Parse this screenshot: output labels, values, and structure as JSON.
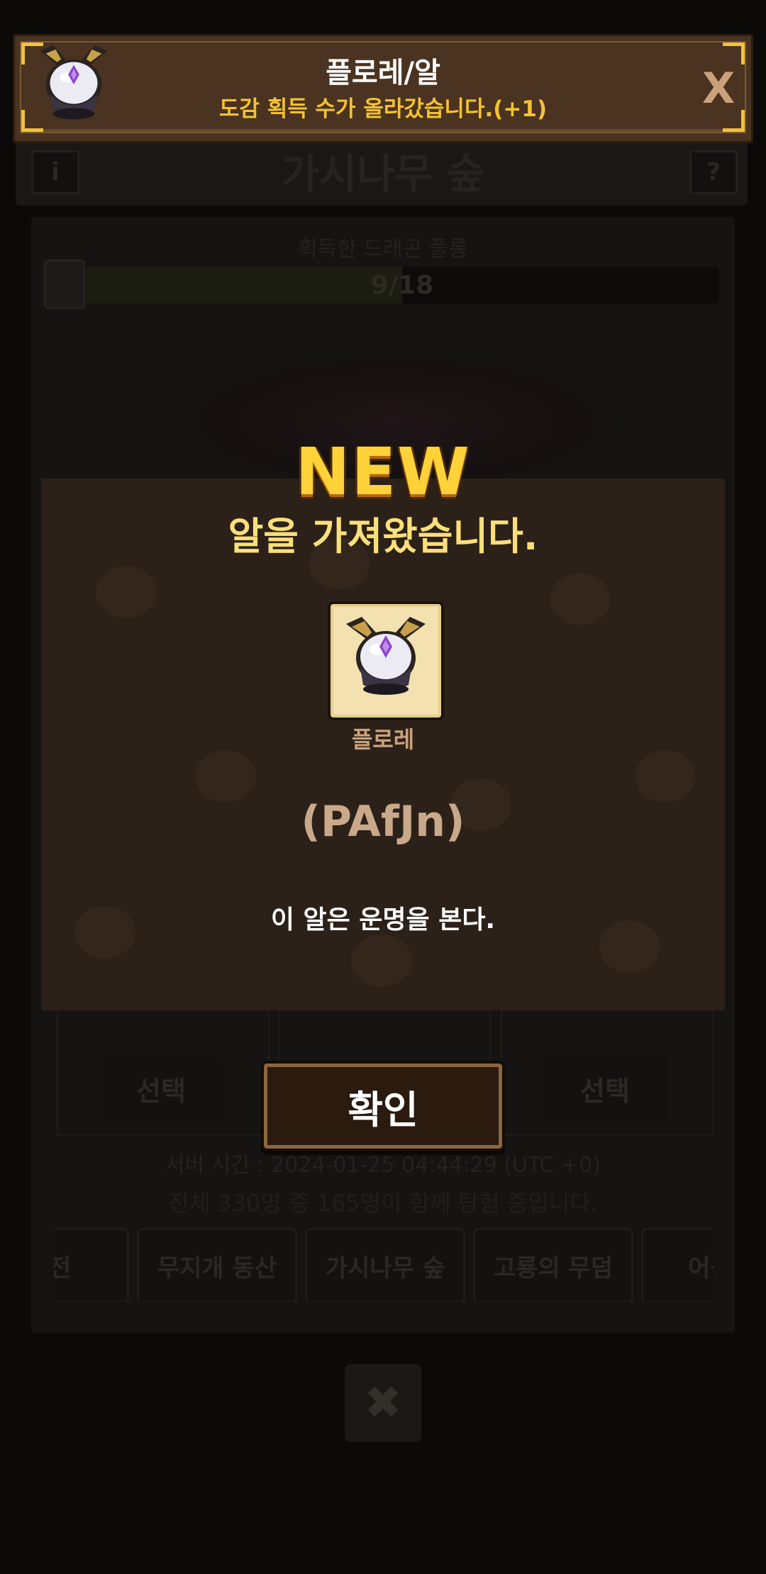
{
  "background": {
    "area_title": "가시나무 숲",
    "info_button": "i",
    "help_button": "?",
    "progress_label": "획득한 드래곤 플롱",
    "progress_value": 0.5,
    "progress_text": "9/18",
    "select_buttons": [
      "선택",
      "선택"
    ],
    "server_time": "서버 시간 : 2024-01-25 04:44:29 (UTC +0)",
    "online_text": "전체 330명 중 165명이 함께 탐험 중입니다.",
    "tabs": [
      "신전",
      "무지개 동산",
      "가시나무 숲",
      "고룡의 무덤",
      "어둠의"
    ],
    "close_button": "✖"
  },
  "toast": {
    "title": "플로레/알",
    "message": "도감 획득 수가 올라갔습니다.(+1)",
    "close_label": "X"
  },
  "modal": {
    "badge": "NEW",
    "title": "알을 가져왔습니다.",
    "item_name": "플로레",
    "item_code": "(PAfJn)",
    "description": "이 알은 운명을 본다.",
    "confirm_label": "확인"
  },
  "colors": {
    "accent_gold": "#f4c232",
    "panel_brown": "#2c2118",
    "toast_brown": "#4a3320"
  }
}
